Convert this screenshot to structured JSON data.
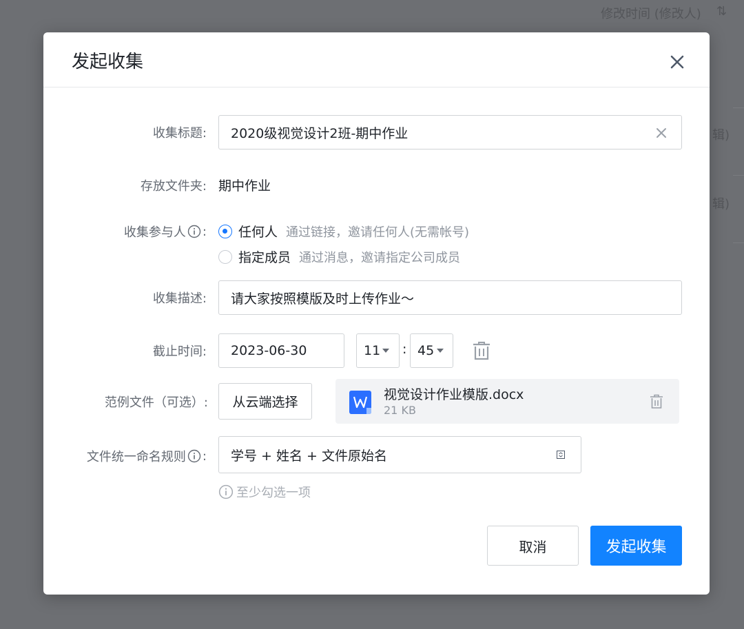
{
  "background": {
    "column_header": "修改时间 (修改人)",
    "row_fragment_1": "辑)",
    "row_fragment_2": "辑)"
  },
  "dialog": {
    "title": "发起收集",
    "fields": {
      "title_label": "收集标题:",
      "title_value": "2020级视觉设计2班-期中作业",
      "folder_label": "存放文件夹:",
      "folder_value": "期中作业",
      "participants_label": "收集参与人",
      "participants_colon": ":",
      "option_anyone": "任何人",
      "option_anyone_hint": "通过链接，邀请任何人(无需帐号)",
      "option_members": "指定成员",
      "option_members_hint": "通过消息，邀请指定公司成员",
      "description_label": "收集描述:",
      "description_value": "请大家按照模版及时上传作业～",
      "deadline_label": "截止时间:",
      "deadline_date": "2023-06-30",
      "deadline_hour": "11",
      "time_separator": ":",
      "deadline_minute": "45",
      "sample_label": "范例文件（可选）:",
      "select_cloud_button": "从云端选择",
      "file_name": "视觉设计作业模版.docx",
      "file_size": "21 KB",
      "naming_label": "文件统一命名规则",
      "naming_colon": ":",
      "naming_value": "学号 + 姓名 + 文件原始名",
      "naming_hint": "至少勾选一项"
    },
    "buttons": {
      "cancel": "取消",
      "submit": "发起收集"
    }
  },
  "colors": {
    "primary": "#1283ff",
    "radio_checked": "#1677ff",
    "doc_icon": "#2b6fff",
    "overlay": "#6d6f73"
  },
  "icons": [
    "close-icon",
    "clear-icon",
    "info-icon",
    "caret-down-icon",
    "trash-icon",
    "word-doc-icon"
  ]
}
